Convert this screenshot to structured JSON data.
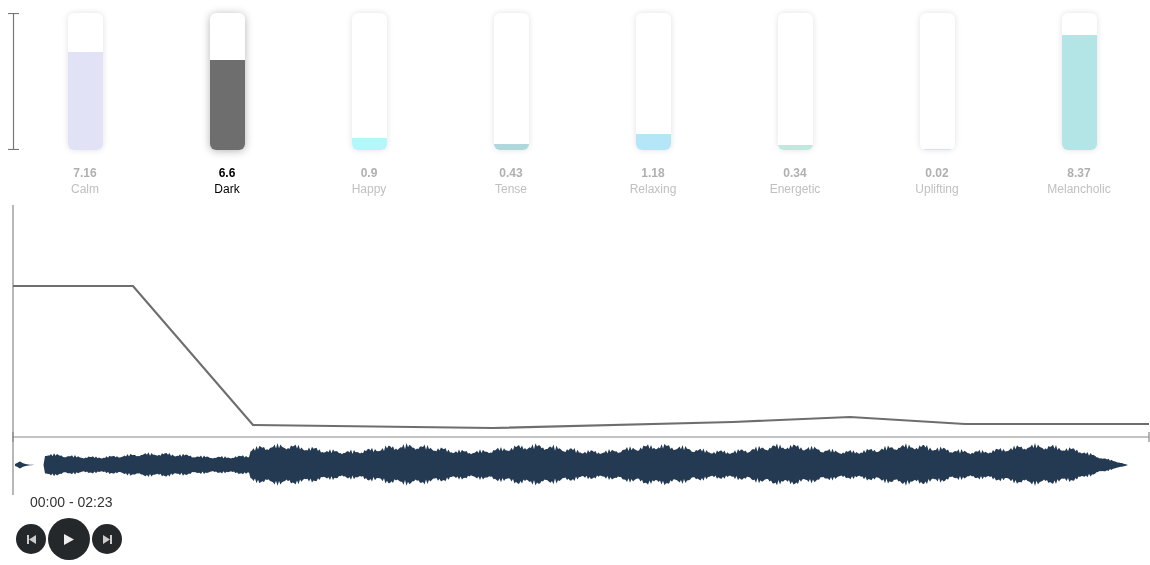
{
  "moods": [
    {
      "name": "Calm",
      "value": "7.16",
      "level": 0.716,
      "color": "#e1e2f6",
      "selected": false
    },
    {
      "name": "Dark",
      "value": "6.6",
      "level": 0.66,
      "color": "#6e6e6e",
      "selected": true
    },
    {
      "name": "Happy",
      "value": "0.9",
      "level": 0.09,
      "color": "#b3f7fb",
      "selected": false
    },
    {
      "name": "Tense",
      "value": "0.43",
      "level": 0.043,
      "color": "#b0d8dc",
      "selected": false
    },
    {
      "name": "Relaxing",
      "value": "1.18",
      "level": 0.118,
      "color": "#b5e6f8",
      "selected": false
    },
    {
      "name": "Energetic",
      "value": "0.34",
      "level": 0.034,
      "color": "#bfe8de",
      "selected": false
    },
    {
      "name": "Uplifting",
      "value": "0.02",
      "level": 0.002,
      "color": "#c8e8ee",
      "selected": false
    },
    {
      "name": "Melancholic",
      "value": "8.37",
      "level": 0.837,
      "color": "#b3e4e6",
      "selected": false
    }
  ],
  "player": {
    "time": "00:00 - 02:23"
  }
}
